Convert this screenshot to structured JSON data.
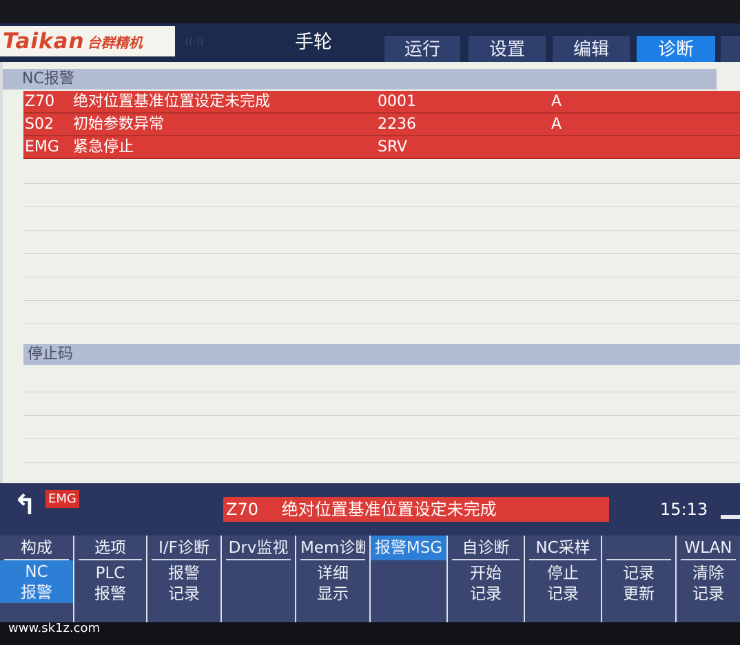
{
  "header": {
    "logo_main": "Taikan",
    "logo_sub": "台群精机",
    "mode": "手轮",
    "tabs": [
      {
        "label": "运行"
      },
      {
        "label": "设置"
      },
      {
        "label": "编辑"
      },
      {
        "label": "诊断"
      },
      {
        "label": ""
      }
    ]
  },
  "nc_alarm": {
    "title": "NC报警",
    "rows": [
      {
        "code": "Z70",
        "message": "绝对位置基准位置设定未完成",
        "number": "0001",
        "axis": "A"
      },
      {
        "code": "S02",
        "message": "初始参数异常",
        "number": "2236",
        "axis": "A"
      },
      {
        "code": "EMG",
        "message": "紧急停止",
        "number": "SRV",
        "axis": ""
      }
    ]
  },
  "stop_code": {
    "title": "停止码"
  },
  "status_bar": {
    "emg": "EMG",
    "current_alarm_code": "Z70",
    "current_alarm_message": "绝对位置基准位置设定未完成",
    "time": "15:13"
  },
  "softkeys": [
    {
      "top": "构成",
      "bottom1": "NC",
      "bottom2": "报警"
    },
    {
      "top": "选项",
      "bottom1": "PLC",
      "bottom2": "报警"
    },
    {
      "top": "I/F诊断",
      "bottom1": "报警",
      "bottom2": "记录"
    },
    {
      "top": "Drv监视",
      "bottom1": "",
      "bottom2": ""
    },
    {
      "top": "Mem诊断",
      "bottom1": "详细",
      "bottom2": "显示"
    },
    {
      "top": "报警MSG",
      "bottom1": "",
      "bottom2": ""
    },
    {
      "top": "自诊断",
      "bottom1": "开始",
      "bottom2": "记录"
    },
    {
      "top": "NC采样",
      "bottom1": "停止",
      "bottom2": "记录"
    },
    {
      "top": "",
      "bottom1": "记录",
      "bottom2": "更新"
    },
    {
      "top": "WLAN",
      "bottom1": "清除",
      "bottom2": "记录"
    }
  ],
  "watermark": "www.sk1z.com",
  "colors": {
    "header_bg": "#1c2a4e",
    "tab_active": "#1d7fe6",
    "alarm_red": "#db3b36",
    "section_head": "#b2bdd4",
    "softkey_bg": "#3a4670",
    "softkey_selected": "#2d7fd6"
  }
}
